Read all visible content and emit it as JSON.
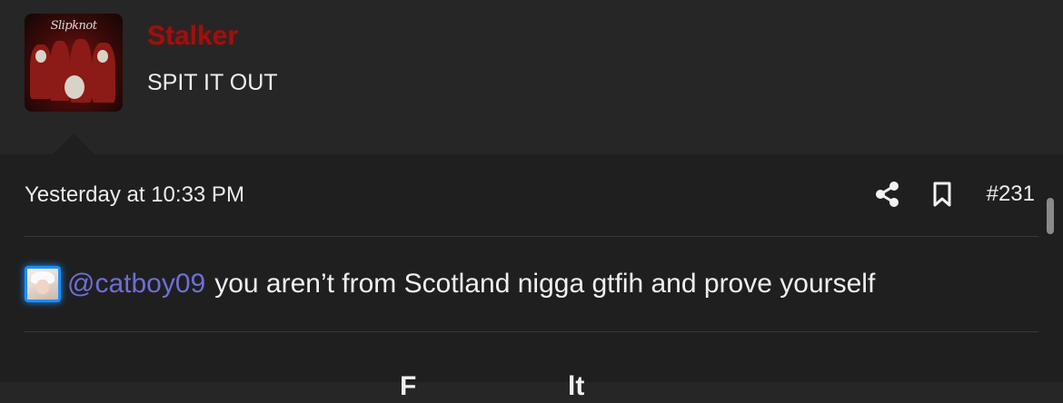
{
  "user": {
    "name": "Stalker",
    "title": "SPIT IT OUT",
    "avatar_text": "Slipknot",
    "name_color": "#a0100c"
  },
  "post": {
    "timestamp": "Yesterday at 10:33 PM",
    "number": "#231",
    "mention": "@catboy09",
    "text": "you aren’t from Scotland nigga gtfih and prove yourself",
    "mention_color": "#6d6fd6"
  },
  "footer": {
    "partial_text": "F                    lt"
  },
  "icons": {
    "share": "share-icon",
    "bookmark": "bookmark-icon"
  }
}
